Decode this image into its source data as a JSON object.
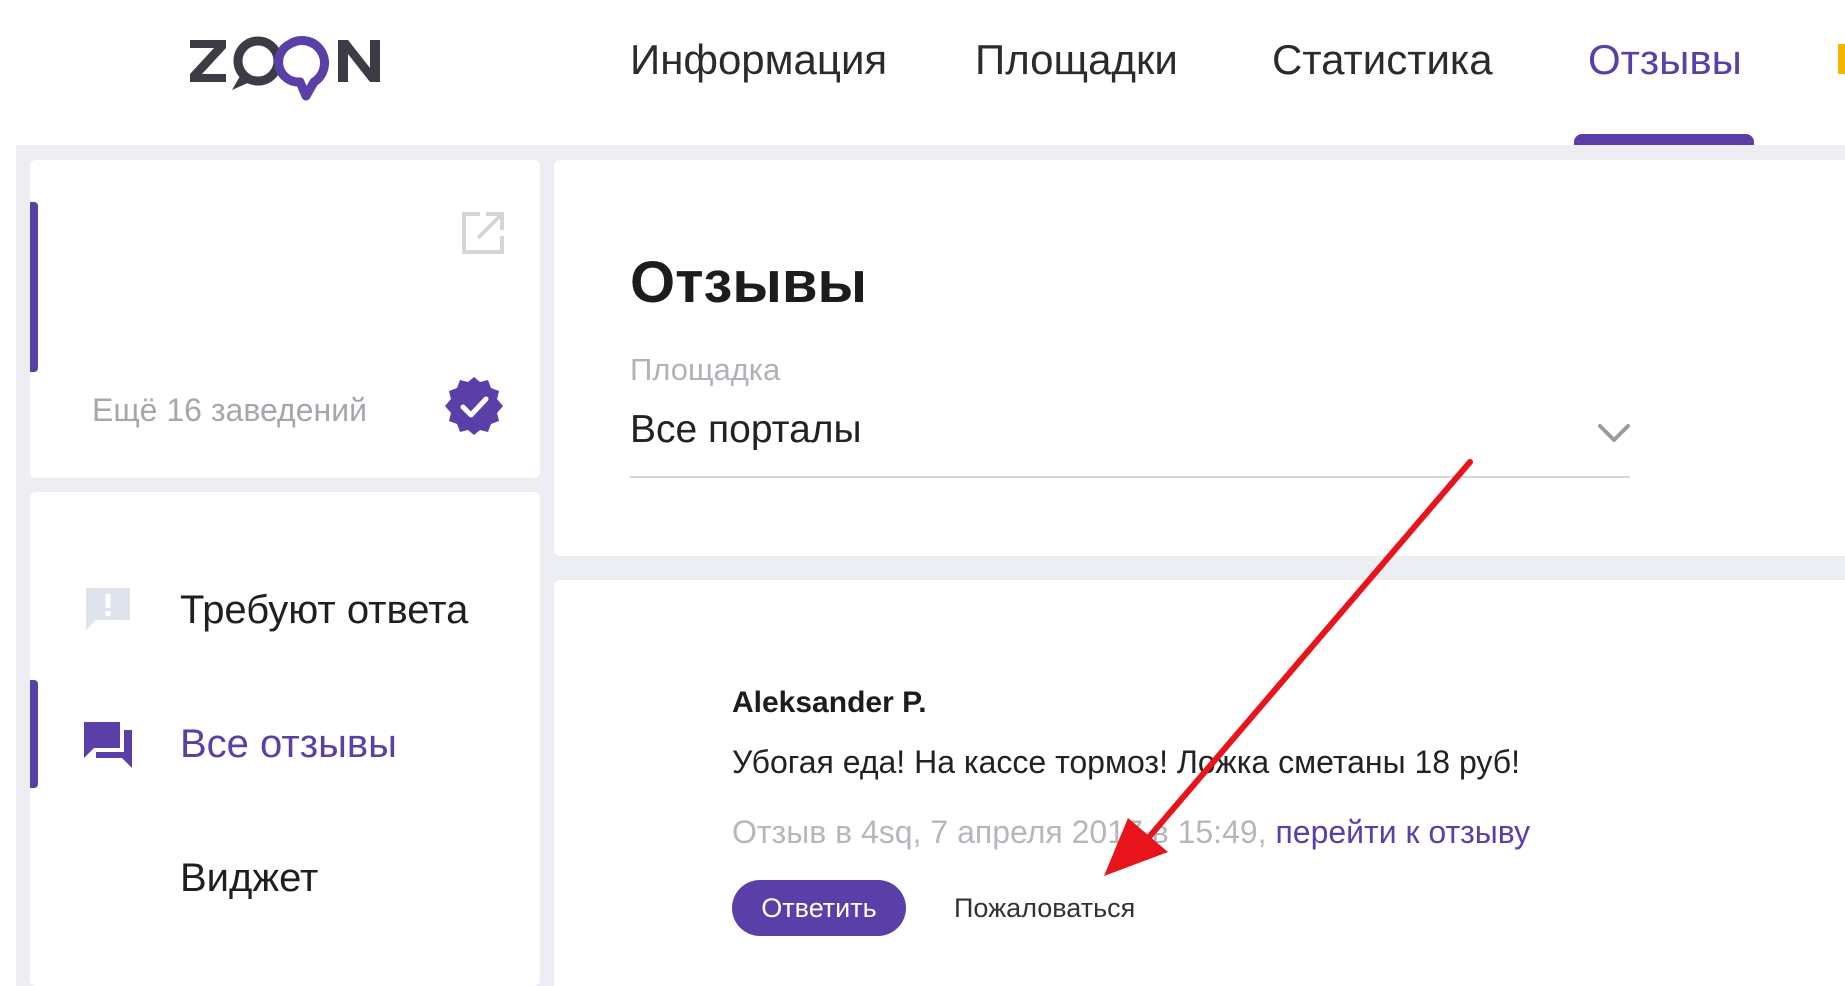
{
  "header": {
    "logo_text": "ZOON",
    "nav": [
      {
        "label": "Информация",
        "active": false
      },
      {
        "label": "Площадки",
        "active": false
      },
      {
        "label": "Статистика",
        "active": false
      },
      {
        "label": "Отзывы",
        "active": true
      }
    ]
  },
  "sidebar": {
    "venue": {
      "more_label": "Ещё 16 заведений",
      "verified": true
    },
    "menu": [
      {
        "label": "Требуют ответа",
        "icon": "alert-message-icon",
        "active": false
      },
      {
        "label": "Все отзывы",
        "icon": "chat-bubbles-icon",
        "active": true
      },
      {
        "label": "Виджет",
        "icon": "",
        "active": false
      }
    ]
  },
  "main": {
    "title": "Отзывы",
    "platform_filter": {
      "label": "Площадка",
      "value": "Все порталы"
    }
  },
  "review": {
    "author": "Aleksander P.",
    "text": "Убогая еда! На кассе тормоз! Ложка сметаны 18 руб!",
    "meta_text": "Отзыв в 4sq, 7 апреля 2017 в 15:49, ",
    "meta_link": "перейти к отзыву",
    "reply_label": "Ответить",
    "report_label": "Пожаловаться"
  },
  "colors": {
    "accent": "#5b3fa8",
    "background": "#eceef3",
    "annotation": "#e8141c"
  }
}
